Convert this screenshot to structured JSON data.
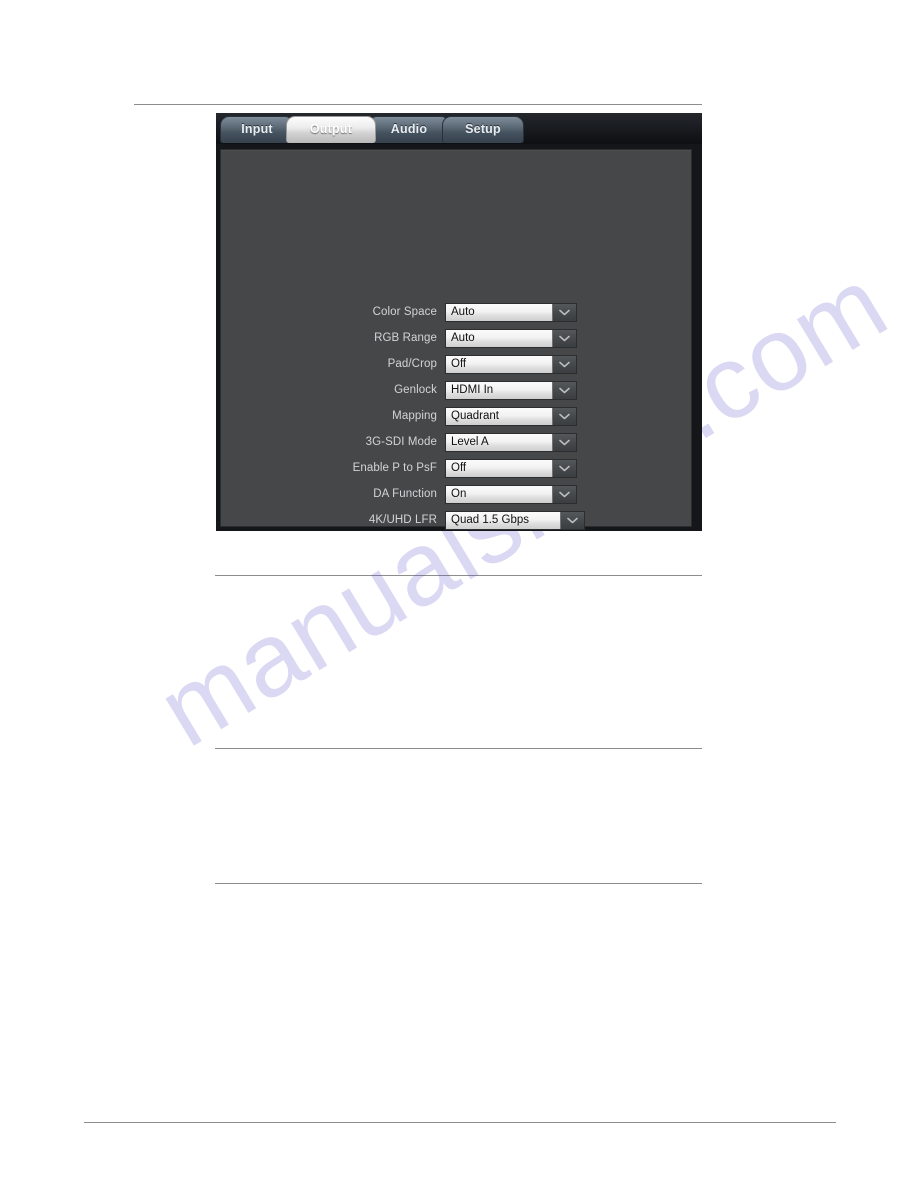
{
  "watermark": {
    "text": "manualshive.com"
  },
  "device_ui": {
    "tabs": [
      {
        "label": "Input",
        "active": false
      },
      {
        "label": "Output",
        "active": true
      },
      {
        "label": "Audio",
        "active": false
      },
      {
        "label": "Setup",
        "active": false
      }
    ],
    "settings": [
      {
        "label": "Color Space",
        "value": "Auto"
      },
      {
        "label": "RGB Range",
        "value": "Auto"
      },
      {
        "label": "Pad/Crop",
        "value": "Off"
      },
      {
        "label": "Genlock",
        "value": "HDMI In"
      },
      {
        "label": "Mapping",
        "value": "Quadrant"
      },
      {
        "label": "3G-SDI Mode",
        "value": "Level A"
      },
      {
        "label": "Enable P to PsF",
        "value": "Off"
      },
      {
        "label": "DA Function",
        "value": "On"
      },
      {
        "label": "4K/UHD LFR",
        "value": "Quad 1.5 Gbps"
      }
    ]
  },
  "colors": {
    "panel_background": "#454749",
    "header_background": "#15181c",
    "active_tab": "#ededed",
    "inactive_tab": "#5d6a77",
    "label_text": "#d2d4d6",
    "value_text": "#101010",
    "watermark": "#5a52c8"
  }
}
